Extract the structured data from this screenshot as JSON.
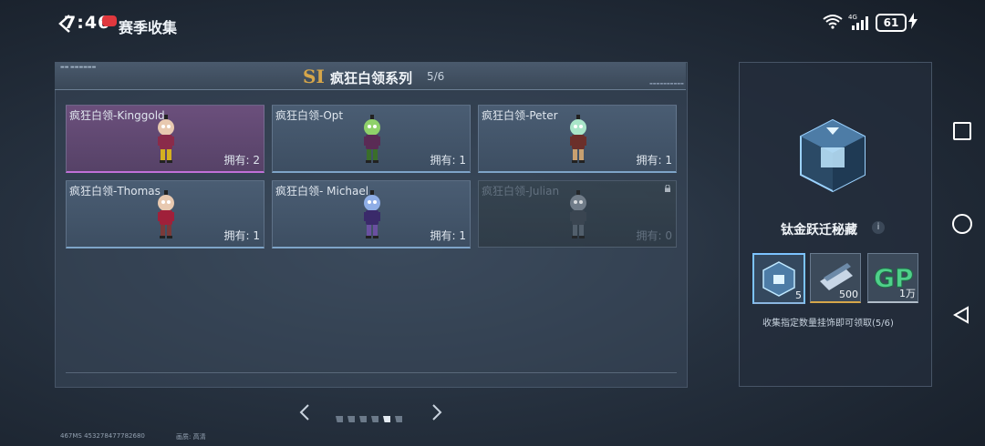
{
  "status_bar": {
    "time": "7:46",
    "battery": "61",
    "network": "4G"
  },
  "header": {
    "title": "赛季收集"
  },
  "series": {
    "logo": "SI",
    "name": "疯狂白领系列",
    "count": "5/6"
  },
  "cards": [
    {
      "name": "疯狂白领-Kinggold",
      "owned": "拥有: 2",
      "color": "#c070d8"
    },
    {
      "name": "疯狂白领-Opt",
      "owned": "拥有: 1",
      "color": "#7ea4c8"
    },
    {
      "name": "疯狂白领-Peter",
      "owned": "拥有: 1",
      "color": "#7ea4c8"
    },
    {
      "name": "疯狂白领-Thomas",
      "owned": "拥有: 1",
      "color": "#7ea4c8"
    },
    {
      "name": "疯狂白领- Michael",
      "owned": "拥有: 1",
      "color": "#7ea4c8"
    },
    {
      "name": "疯狂白领-Julian",
      "owned": "拥有: 0",
      "color": "#555f6a"
    }
  ],
  "pager": {
    "total": 6,
    "active": 5
  },
  "footer": {
    "ms_id": "467MS  453278477782680",
    "quality": "画质:  高清"
  },
  "reward": {
    "title": "钛金跃迁秘藏",
    "items": [
      {
        "icon": "cube-box-icon",
        "value": "5"
      },
      {
        "icon": "ticket-icon",
        "value": "500"
      },
      {
        "icon": "gp-coin-icon",
        "value": "1万"
      }
    ],
    "description": "收集指定数量挂饰即可领取(5/6)"
  },
  "colors": {
    "accent_blue": "#7cc3ff",
    "gold": "#d6a64a",
    "purple": "#c070d8"
  }
}
